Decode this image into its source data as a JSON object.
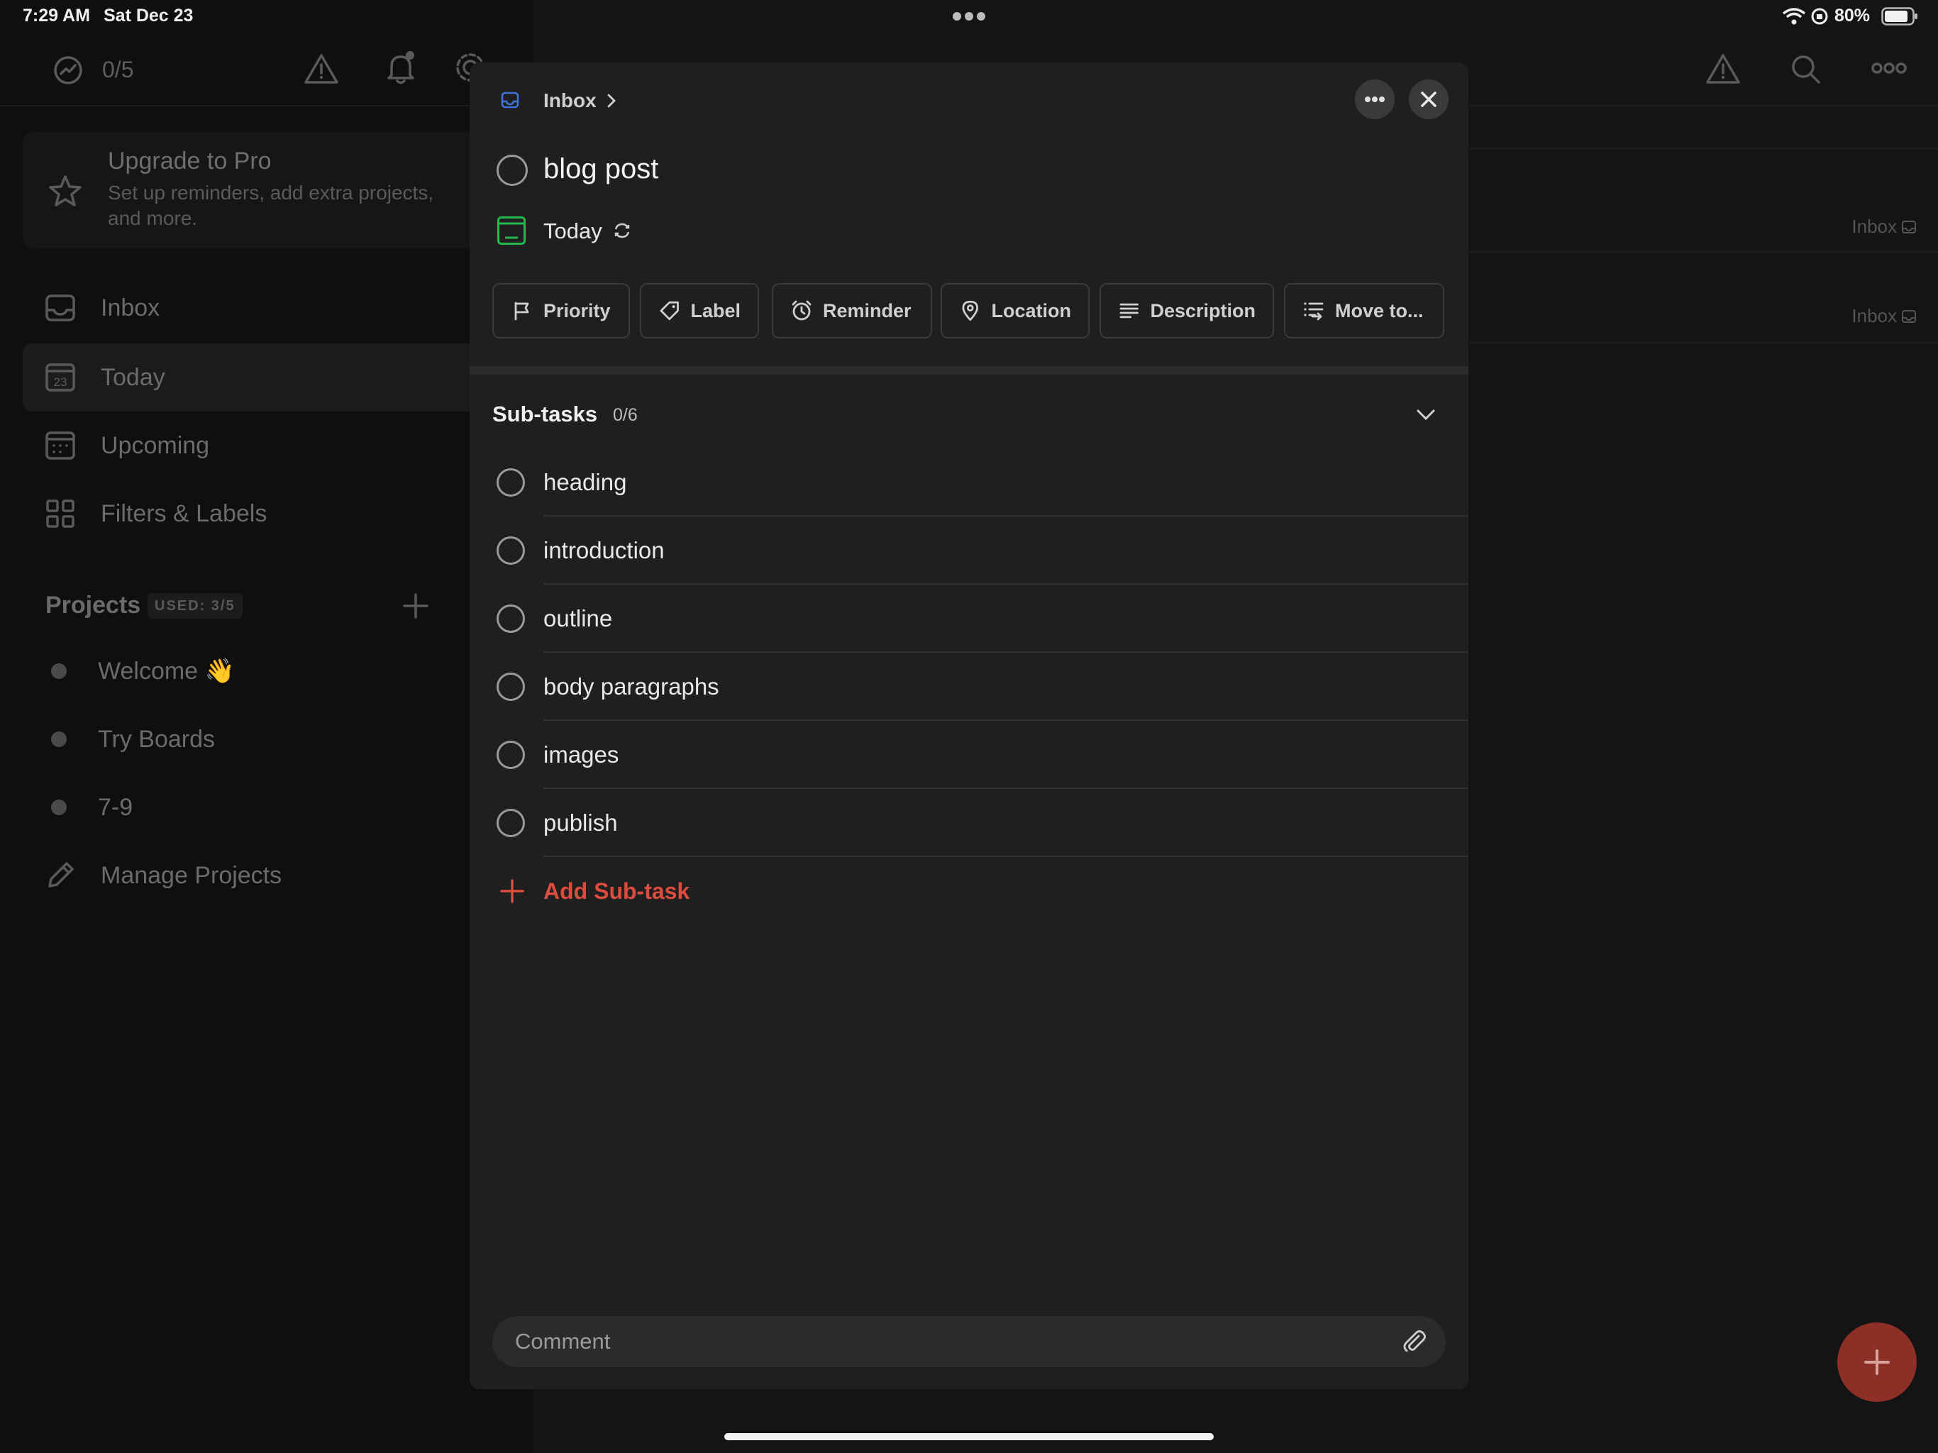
{
  "status_bar": {
    "time": "7:29 AM",
    "date": "Sat Dec 23",
    "battery": "80%"
  },
  "background": {
    "karma_count": "0/5",
    "upgrade": {
      "title": "Upgrade to Pro",
      "subtitle_line1": "Set up reminders, add extra projects,",
      "subtitle_line2": "and more."
    },
    "nav": [
      {
        "label": "Inbox",
        "icon": "inbox-icon"
      },
      {
        "label": "Today",
        "icon": "calendar-today-icon",
        "date": "23"
      },
      {
        "label": "Upcoming",
        "icon": "calendar-upcoming-icon"
      },
      {
        "label": "Filters & Labels",
        "icon": "grid-icon"
      }
    ],
    "projects": {
      "title": "Projects",
      "badge": "USED: 3/5",
      "items": [
        "Welcome 👋",
        "Try Boards",
        "7-9"
      ],
      "manage": "Manage Projects"
    },
    "task_rows": [
      {
        "project": "Inbox"
      },
      {
        "project": "Inbox"
      }
    ]
  },
  "modal": {
    "breadcrumb": "Inbox",
    "task_title": "blog post",
    "due": "Today",
    "chips": [
      "Priority",
      "Label",
      "Reminder",
      "Location",
      "Description",
      "Move to..."
    ],
    "subtasks": {
      "title": "Sub-tasks",
      "count": "0/6",
      "items": [
        "heading",
        "introduction",
        "outline",
        "body paragraphs",
        "images",
        "publish"
      ],
      "add_label": "Add Sub-task"
    },
    "comment_placeholder": "Comment"
  },
  "colors": {
    "accent_red": "#dc4c3e",
    "today_green": "#25b84c",
    "inbox_blue": "#4073d6"
  }
}
